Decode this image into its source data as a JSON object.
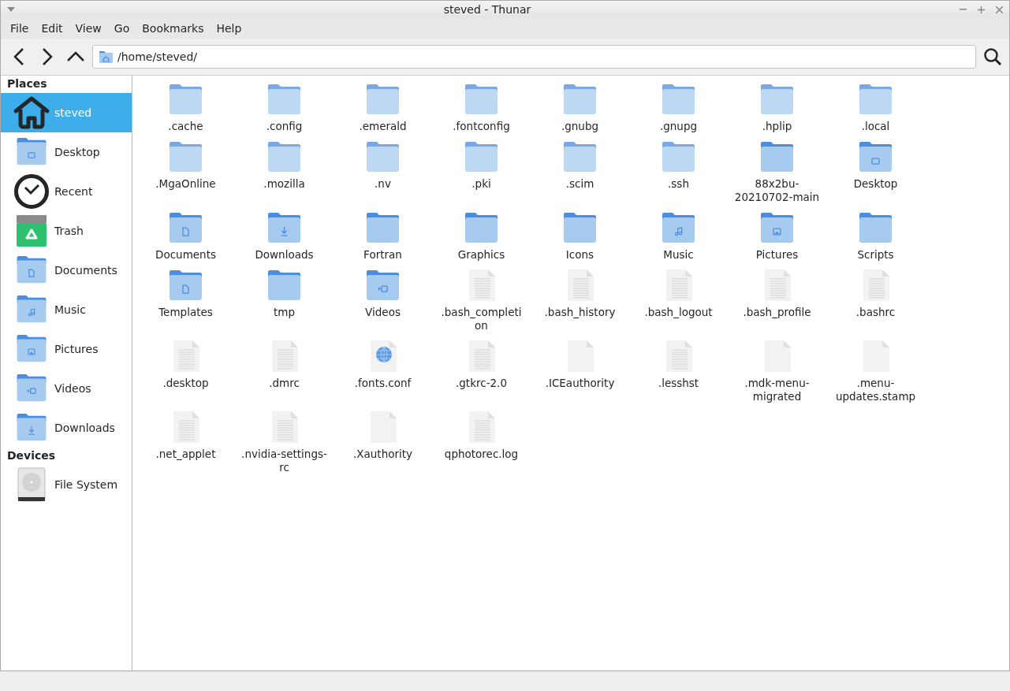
{
  "window": {
    "title": "steved - Thunar"
  },
  "menu": [
    "File",
    "Edit",
    "View",
    "Go",
    "Bookmarks",
    "Help"
  ],
  "location": {
    "value": "/home/steved/"
  },
  "sidebar": {
    "sections": [
      {
        "title": "Places",
        "items": [
          {
            "label": "steved",
            "kind": "home",
            "selected": true
          },
          {
            "label": "Desktop",
            "kind": "desktop",
            "selected": false
          },
          {
            "label": "Recent",
            "kind": "recent",
            "selected": false
          },
          {
            "label": "Trash",
            "kind": "trash",
            "selected": false
          },
          {
            "label": "Documents",
            "kind": "documents",
            "selected": false
          },
          {
            "label": "Music",
            "kind": "music",
            "selected": false
          },
          {
            "label": "Pictures",
            "kind": "pictures",
            "selected": false
          },
          {
            "label": "Videos",
            "kind": "videos",
            "selected": false
          },
          {
            "label": "Downloads",
            "kind": "downloads",
            "selected": false
          }
        ]
      },
      {
        "title": "Devices",
        "items": [
          {
            "label": "File System",
            "kind": "drive",
            "selected": false
          }
        ]
      }
    ]
  },
  "files": [
    {
      "name": ".cache",
      "kind": "hidden"
    },
    {
      "name": ".config",
      "kind": "hidden"
    },
    {
      "name": ".emerald",
      "kind": "hidden"
    },
    {
      "name": ".fontconfig",
      "kind": "hidden"
    },
    {
      "name": ".gnubg",
      "kind": "hidden"
    },
    {
      "name": ".gnupg",
      "kind": "hidden"
    },
    {
      "name": ".hplip",
      "kind": "hidden"
    },
    {
      "name": ".local",
      "kind": "hidden"
    },
    {
      "name": ".MgaOnline",
      "kind": "hidden"
    },
    {
      "name": ".mozilla",
      "kind": "hidden"
    },
    {
      "name": ".nv",
      "kind": "hidden"
    },
    {
      "name": ".pki",
      "kind": "hidden"
    },
    {
      "name": ".scim",
      "kind": "hidden"
    },
    {
      "name": ".ssh",
      "kind": "hidden"
    },
    {
      "name": "88x2bu-20210702-main",
      "kind": "folder"
    },
    {
      "name": "Desktop",
      "kind": "desktop"
    },
    {
      "name": "Documents",
      "kind": "documents"
    },
    {
      "name": "Downloads",
      "kind": "downloads"
    },
    {
      "name": "Fortran",
      "kind": "folder"
    },
    {
      "name": "Graphics",
      "kind": "folder"
    },
    {
      "name": "Icons",
      "kind": "folder"
    },
    {
      "name": "Music",
      "kind": "music"
    },
    {
      "name": "Pictures",
      "kind": "pictures"
    },
    {
      "name": "Scripts",
      "kind": "folder"
    },
    {
      "name": "Templates",
      "kind": "templates"
    },
    {
      "name": "tmp",
      "kind": "folder"
    },
    {
      "name": "Videos",
      "kind": "videos"
    },
    {
      "name": ".bash_completion",
      "kind": "text"
    },
    {
      "name": ".bash_history",
      "kind": "text"
    },
    {
      "name": ".bash_logout",
      "kind": "text"
    },
    {
      "name": ".bash_profile",
      "kind": "text"
    },
    {
      "name": ".bashrc",
      "kind": "text"
    },
    {
      "name": ".desktop",
      "kind": "text"
    },
    {
      "name": ".dmrc",
      "kind": "text"
    },
    {
      "name": ".fonts.conf",
      "kind": "web"
    },
    {
      "name": ".gtkrc-2.0",
      "kind": "text"
    },
    {
      "name": ".ICEauthority",
      "kind": "blank"
    },
    {
      "name": ".lesshst",
      "kind": "text"
    },
    {
      "name": ".mdk-menu-migrated",
      "kind": "blank"
    },
    {
      "name": ".menu-updates.stamp",
      "kind": "blank"
    },
    {
      "name": ".net_applet",
      "kind": "text"
    },
    {
      "name": ".nvidia-settings-rc",
      "kind": "text"
    },
    {
      "name": ".Xauthority",
      "kind": "blank"
    },
    {
      "name": "qphotorec.log",
      "kind": "text"
    }
  ]
}
